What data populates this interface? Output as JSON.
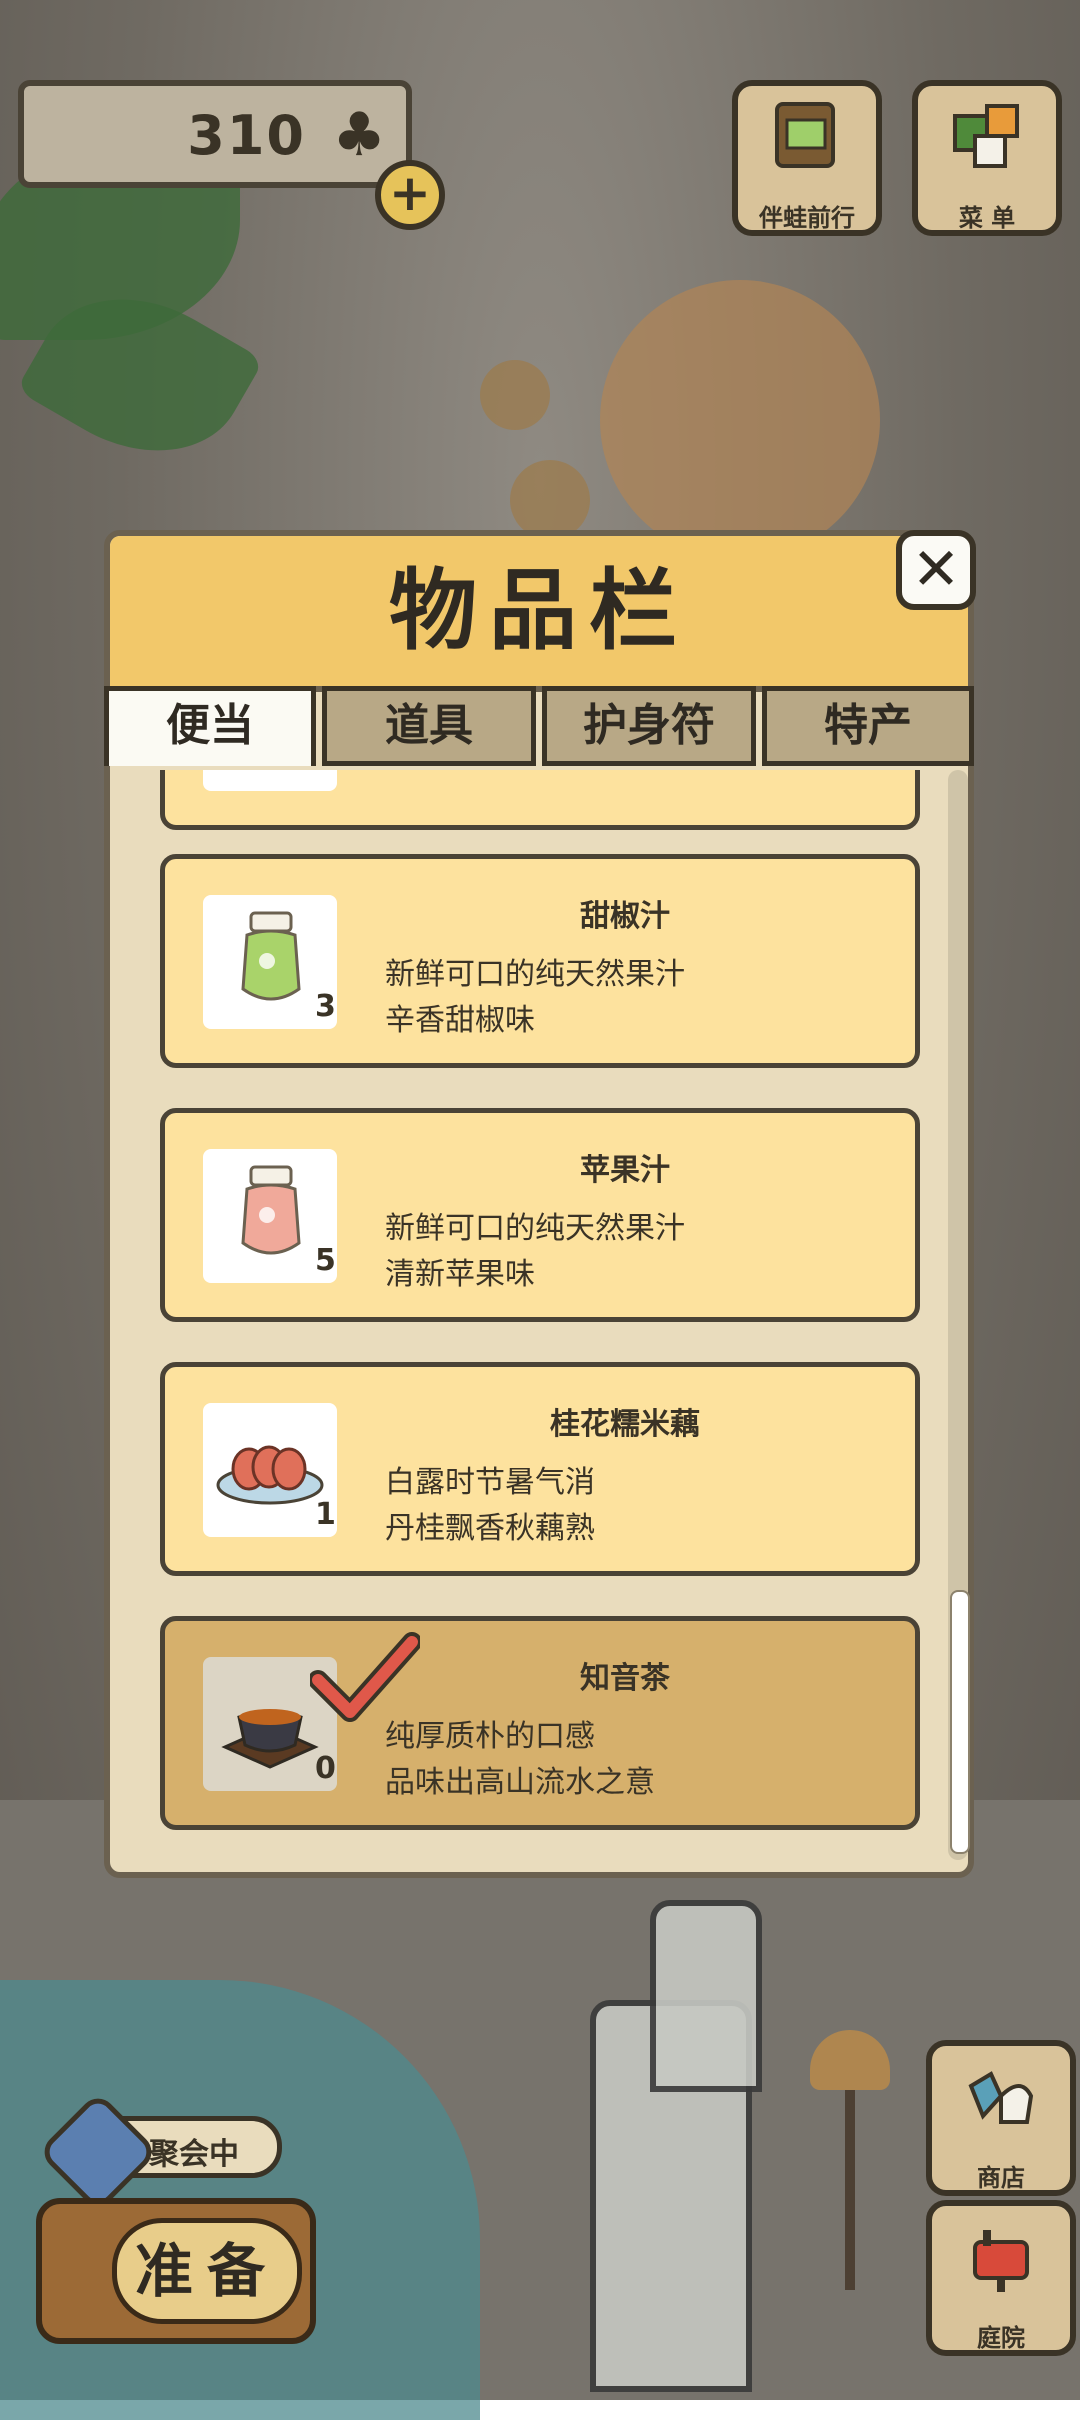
{
  "currency": {
    "clover_count": "310",
    "clover_icon": "clover-icon",
    "plus_label": "+"
  },
  "top_buttons": [
    {
      "label": "伴蛙前行",
      "icon": "album-icon"
    },
    {
      "label": "菜 单",
      "icon": "menu-icon"
    }
  ],
  "panel": {
    "title": "物品栏",
    "close_label": "✕",
    "tabs": [
      "便当",
      "道具",
      "护身符",
      "特产"
    ],
    "active_tab": "便当"
  },
  "items": [
    {
      "name": "甜椒汁",
      "desc1": "新鲜可口的纯天然果汁",
      "desc2": "辛香甜椒味",
      "qty": "3",
      "icon": "green-juice-jar-icon",
      "color": "#a9d36a"
    },
    {
      "name": "苹果汁",
      "desc1": "新鲜可口的纯天然果汁",
      "desc2": "清新苹果味",
      "qty": "5",
      "icon": "pink-juice-jar-icon",
      "color": "#f0a99a"
    },
    {
      "name": "桂花糯米藕",
      "desc1": "白露时节暑气消",
      "desc2": "丹桂飘香秋藕熟",
      "qty": "1",
      "icon": "lotus-root-plate-icon",
      "color": "#e0705a"
    },
    {
      "name": "知音茶",
      "desc1": "纯厚质朴的口感",
      "desc2": "品味出高山流水之意",
      "qty": "0",
      "icon": "tea-bowl-icon",
      "color": "#c0641e",
      "selected": true
    }
  ],
  "bottom": {
    "party_label": "聚会中",
    "prepare_label": "准备",
    "side_buttons": [
      {
        "label": "商店",
        "icon": "shop-bag-icon"
      },
      {
        "label": "庭院",
        "icon": "yard-mailbox-icon"
      }
    ]
  },
  "colors": {
    "panel_header": "#f2c86a",
    "card": "#fde29e",
    "card_selected": "#d6b06c",
    "check": "#e0584a"
  }
}
